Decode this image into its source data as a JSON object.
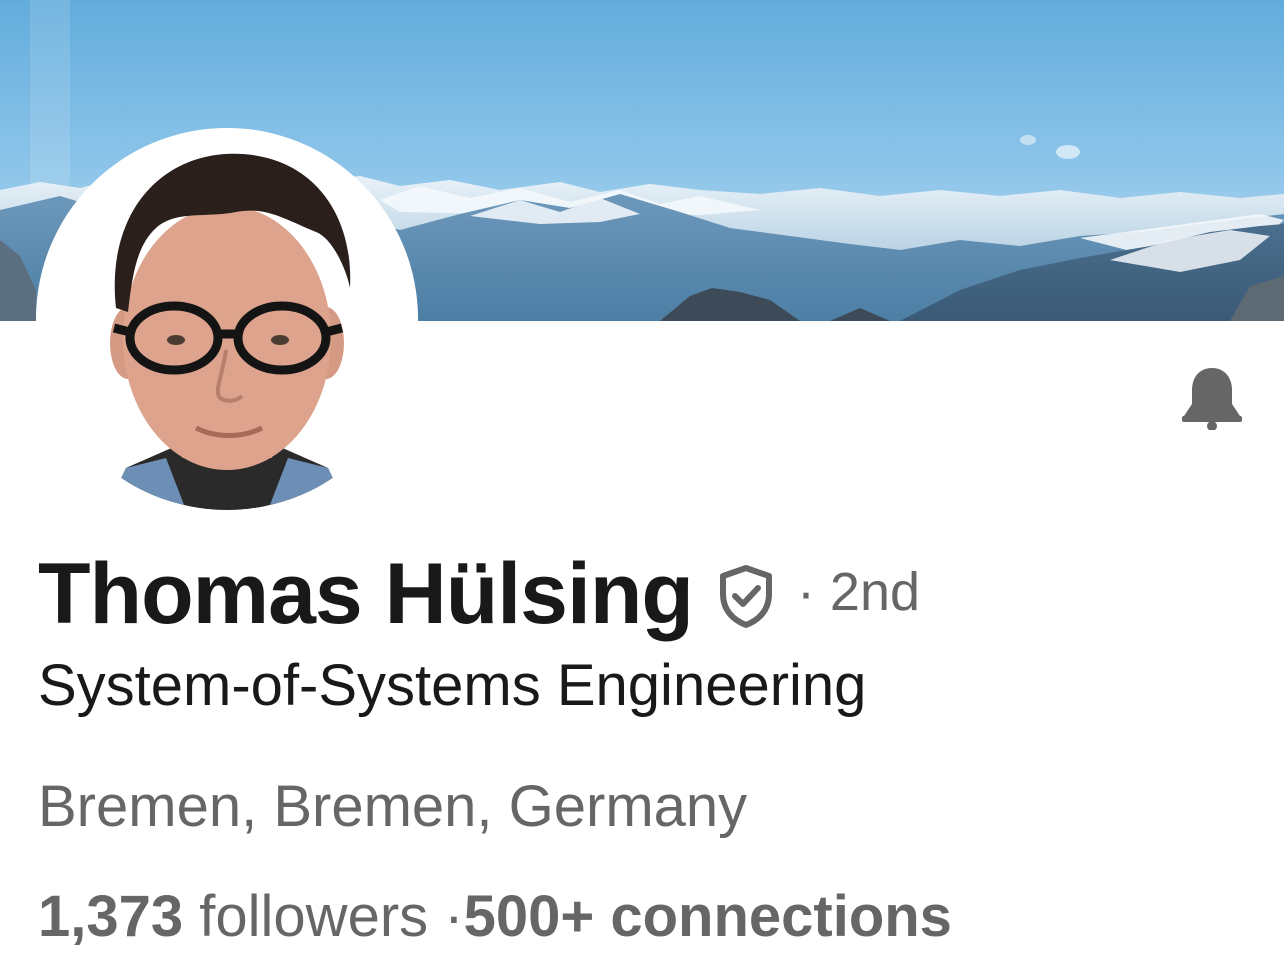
{
  "profile": {
    "name": "Thomas Hülsing",
    "degree": "· 2nd",
    "headline": "System-of-Systems Engineering",
    "location": "Bremen, Bremen, Germany",
    "followers_count": "1,373",
    "followers_label": "followers",
    "separator": " ·",
    "connections": "500+ connections"
  },
  "icons": {
    "verified": "verified-shield-icon",
    "bell": "bell-icon"
  },
  "colors": {
    "text_primary": "#191919",
    "text_secondary": "#666666",
    "icon_gray": "#666666",
    "sky_top": "#5aa6d9",
    "sky_bottom": "#bfe0f4"
  }
}
